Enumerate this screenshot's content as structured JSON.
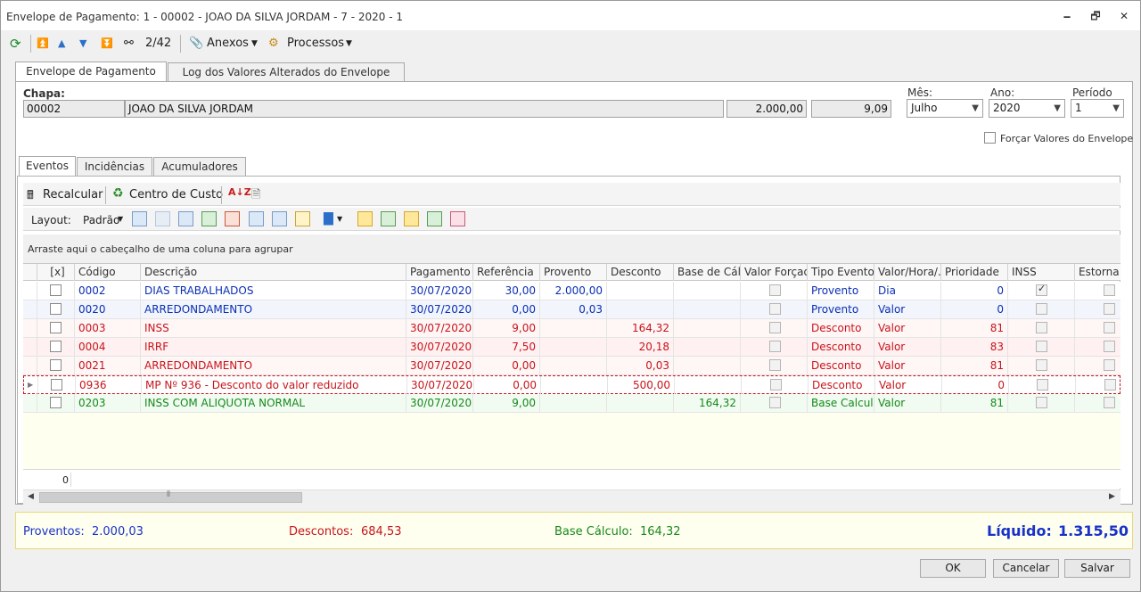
{
  "window": {
    "title": "Envelope de Pagamento: 1 - 00002 - JOAO DA SILVA JORDAM - 7 - 2020 - 1",
    "minimize": "🗕",
    "restore": "🗗",
    "close": "✕"
  },
  "toolbar": {
    "record_position": "2/42",
    "attachments_label": "Anexos",
    "processes_label": "Processos"
  },
  "tabs": {
    "main": "Envelope de Pagamento",
    "log": "Log dos Valores Alterados do Envelope"
  },
  "header": {
    "chapa_label": "Chapa:",
    "chapa_value": "00002",
    "name_value": "JOAO DA SILVA JORDAM",
    "salary_value": "2.000,00",
    "hour_value": "9,09",
    "mes_label": "Mês:",
    "mes_value": "Julho",
    "ano_label": "Ano:",
    "ano_value": "2020",
    "periodo_label": "Período",
    "periodo_value": "1",
    "force_label": "Forçar Valores do Envelope"
  },
  "subtabs": {
    "eventos": "Eventos",
    "incidencias": "Incidências",
    "acumuladores": "Acumuladores"
  },
  "actions": {
    "recalcular": "Recalcular",
    "centro_custo": "Centro de Custo"
  },
  "layout": {
    "label": "Layout:",
    "value": "Padrão"
  },
  "group_hint": "Arraste aqui o cabeçalho de uma coluna para agrupar",
  "grid": {
    "columns": [
      "[x]",
      "Código",
      "Descrição",
      "Pagamento",
      "Referência",
      "Provento",
      "Desconto",
      "Base de Cál...",
      "Valor Forçado",
      "Tipo Evento",
      "Valor/Hora/...",
      "Prioridade",
      "INSS",
      "Estorna IR"
    ],
    "rows": [
      {
        "codigo": "0002",
        "descricao": "DIAS TRABALHADOS",
        "pagamento": "30/07/2020",
        "referencia": "30,00",
        "provento": "2.000,00",
        "desconto": "",
        "base": "",
        "tipo": "Provento",
        "valor_hora": "Dia",
        "prioridade": "0",
        "inss": true,
        "color": "#0b2fb5",
        "bg": "#ffffff"
      },
      {
        "codigo": "0020",
        "descricao": "ARREDONDAMENTO",
        "pagamento": "30/07/2020",
        "referencia": "0,00",
        "provento": "0,03",
        "desconto": "",
        "base": "",
        "tipo": "Provento",
        "valor_hora": "Valor",
        "prioridade": "0",
        "inss": false,
        "color": "#0b2fb5",
        "bg": "#f2f6fc"
      },
      {
        "codigo": "0003",
        "descricao": "INSS",
        "pagamento": "30/07/2020",
        "referencia": "9,00",
        "provento": "",
        "desconto": "164,32",
        "base": "",
        "tipo": "Desconto",
        "valor_hora": "Valor",
        "prioridade": "81",
        "inss": false,
        "color": "#c8141b",
        "bg": "#fff6f6"
      },
      {
        "codigo": "0004",
        "descricao": "IRRF",
        "pagamento": "30/07/2020",
        "referencia": "7,50",
        "provento": "",
        "desconto": "20,18",
        "base": "",
        "tipo": "Desconto",
        "valor_hora": "Valor",
        "prioridade": "83",
        "inss": false,
        "color": "#c8141b",
        "bg": "#fff1f1"
      },
      {
        "codigo": "0021",
        "descricao": "ARREDONDAMENTO",
        "pagamento": "30/07/2020",
        "referencia": "0,00",
        "provento": "",
        "desconto": "0,03",
        "base": "",
        "tipo": "Desconto",
        "valor_hora": "Valor",
        "prioridade": "81",
        "inss": false,
        "color": "#c8141b",
        "bg": "#fff6f6"
      },
      {
        "codigo": "0936",
        "descricao": "MP Nº 936 - Desconto do valor reduzido",
        "pagamento": "30/07/2020",
        "referencia": "0,00",
        "provento": "",
        "desconto": "500,00",
        "base": "",
        "tipo": "Desconto",
        "valor_hora": "Valor",
        "prioridade": "0",
        "inss": false,
        "color": "#c8141b",
        "bg": "#ffffff"
      },
      {
        "codigo": "0203",
        "descricao": "INSS COM ALIQUOTA NORMAL",
        "pagamento": "30/07/2020",
        "referencia": "9,00",
        "provento": "",
        "desconto": "",
        "base": "164,32",
        "tipo": "Base Calculo",
        "valor_hora": "Valor",
        "prioridade": "81",
        "inss": false,
        "color": "#178a1b",
        "bg": "#f1fbf1"
      }
    ],
    "footer_count": "0"
  },
  "totals": {
    "proventos_label": "Proventos:",
    "proventos_value": "2.000,03",
    "descontos_label": "Descontos:",
    "descontos_value": "684,53",
    "base_label": "Base Cálculo:",
    "base_value": "164,32",
    "liquido_label": "Líquido:",
    "liquido_value": "1.315,50"
  },
  "buttons": {
    "ok": "OK",
    "cancelar": "Cancelar",
    "salvar": "Salvar"
  }
}
